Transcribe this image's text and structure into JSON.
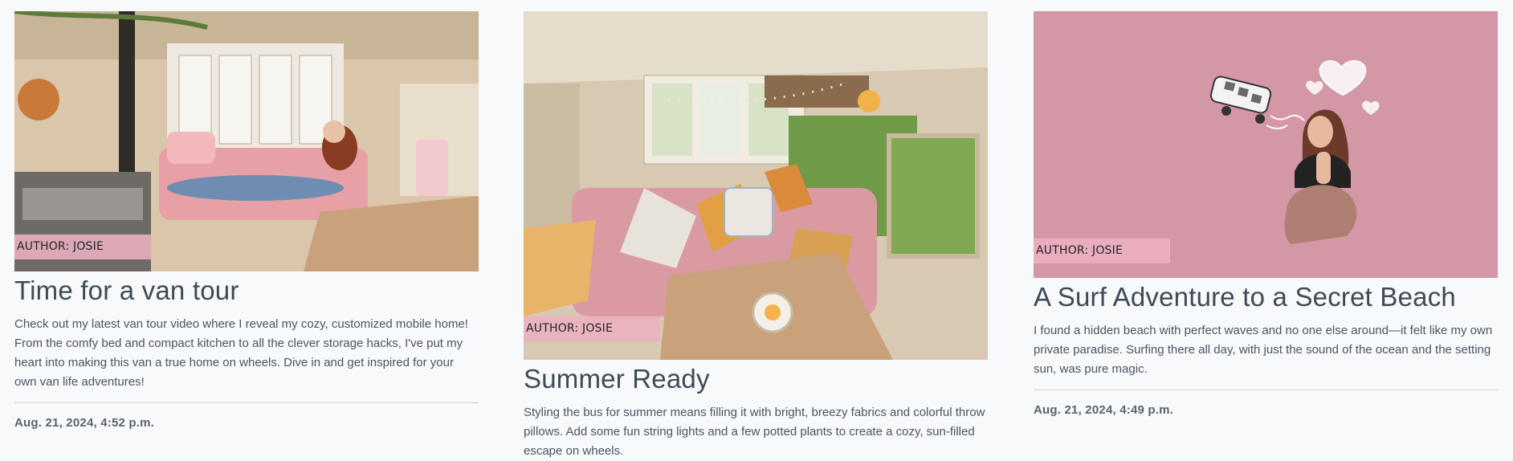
{
  "posts": [
    {
      "author": "AUTHOR: JOSIE",
      "title": "Time for a van tour",
      "description": "Check out my latest van tour video where I reveal my cozy, customized mobile home! From the comfy bed and compact kitchen to all the clever storage hacks, I've put my heart into making this van a true home on wheels. Dive in and get inspired for your own van life adventures!",
      "date": "Aug. 21, 2024, 4:52 p.m."
    },
    {
      "author": "AUTHOR: JOSIE",
      "title": "Summer Ready",
      "description": "Styling the bus for summer means filling it with bright, breezy fabrics and colorful throw pillows. Add some fun string lights and a few potted plants to create a cozy, sun-filled escape on wheels.",
      "date": ""
    },
    {
      "author": "AUTHOR: JOSIE",
      "title": "A Surf Adventure to a Secret Beach",
      "description": "I found a hidden beach with perfect waves and no one else around—it felt like my own private paradise. Surfing there all day, with just the sound of the ocean and the setting sun, was pure magic.",
      "date": "Aug. 21, 2024, 4:49 p.m."
    }
  ],
  "colors": {
    "page_background": "#f7f9fb",
    "author_badge": "#ecb0c0",
    "surf_image_background": "#d497a6",
    "text": "#3e4a56"
  }
}
